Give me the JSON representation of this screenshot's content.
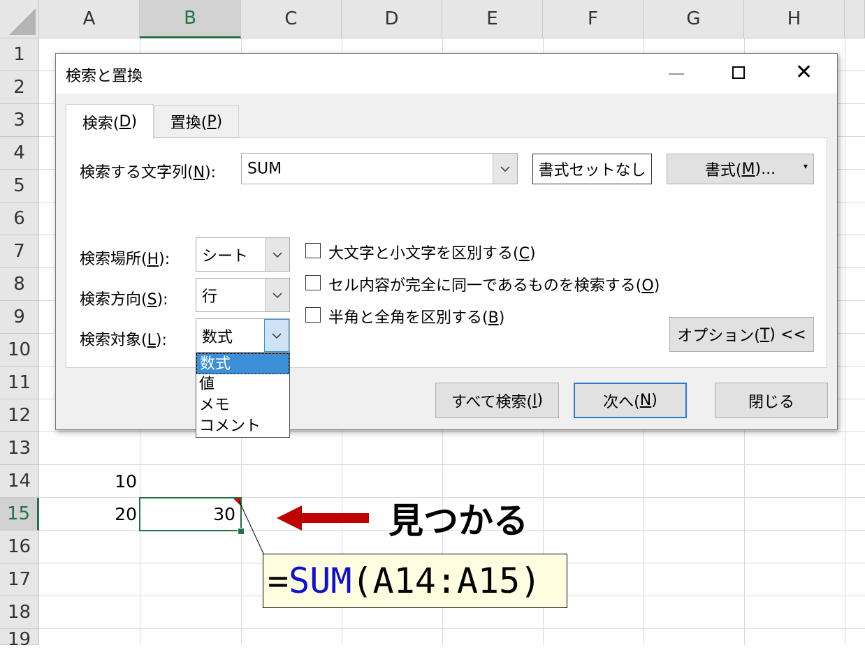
{
  "sheet": {
    "columns": [
      "A",
      "B",
      "C",
      "D",
      "E",
      "F",
      "G",
      "H"
    ],
    "selected_column": "B",
    "rows": [
      "1",
      "2",
      "3",
      "4",
      "5",
      "6",
      "7",
      "8",
      "9",
      "10",
      "11",
      "12",
      "13",
      "14",
      "15",
      "16",
      "17",
      "18",
      "19"
    ],
    "selected_row": "15",
    "cells": {
      "A14": "10",
      "A15": "20",
      "B15": "30"
    }
  },
  "dialog": {
    "title": "検索と置換",
    "tabs": {
      "find": {
        "text": "検索(",
        "key": "D",
        "end": ")"
      },
      "replace": {
        "text": "置換(",
        "key": "P",
        "end": ")"
      }
    },
    "find_what": {
      "text": "検索する文字列(",
      "key": "N",
      "end": "):",
      "value": "SUM"
    },
    "no_format_button": "書式セットなし",
    "format_button": {
      "text": "書式(",
      "key": "M",
      "end": ")..."
    },
    "within": {
      "text": "検索場所(",
      "key": "H",
      "end": "):",
      "value": "シート"
    },
    "search": {
      "text": "検索方向(",
      "key": "S",
      "end": "):",
      "value": "行"
    },
    "look_in": {
      "text": "検索対象(",
      "key": "L",
      "end": "):",
      "value": "数式",
      "options": [
        "数式",
        "値",
        "メモ",
        "コメント"
      ]
    },
    "checkboxes": [
      {
        "text": "大文字と小文字を区別する(",
        "key": "C",
        "end": ")"
      },
      {
        "text": "セル内容が完全に同一であるものを検索する(",
        "key": "O",
        "end": ")"
      },
      {
        "text": "半角と全角を区別する(",
        "key": "B",
        "end": ")"
      }
    ],
    "options_button": {
      "text": "オプション(",
      "key": "T",
      "end": ") <<"
    },
    "find_all_button": {
      "text": "すべて検索(",
      "key": "I",
      "end": ")"
    },
    "find_next_button": {
      "text": "次へ(",
      "key": "N",
      "end": ")"
    },
    "close_button": "閉じる"
  },
  "annotation": {
    "found_label": "見つかる",
    "formula_prefix": "=",
    "formula_function": "SUM",
    "formula_args": "(A14:A15)",
    "arrow_color": "#c00000"
  }
}
